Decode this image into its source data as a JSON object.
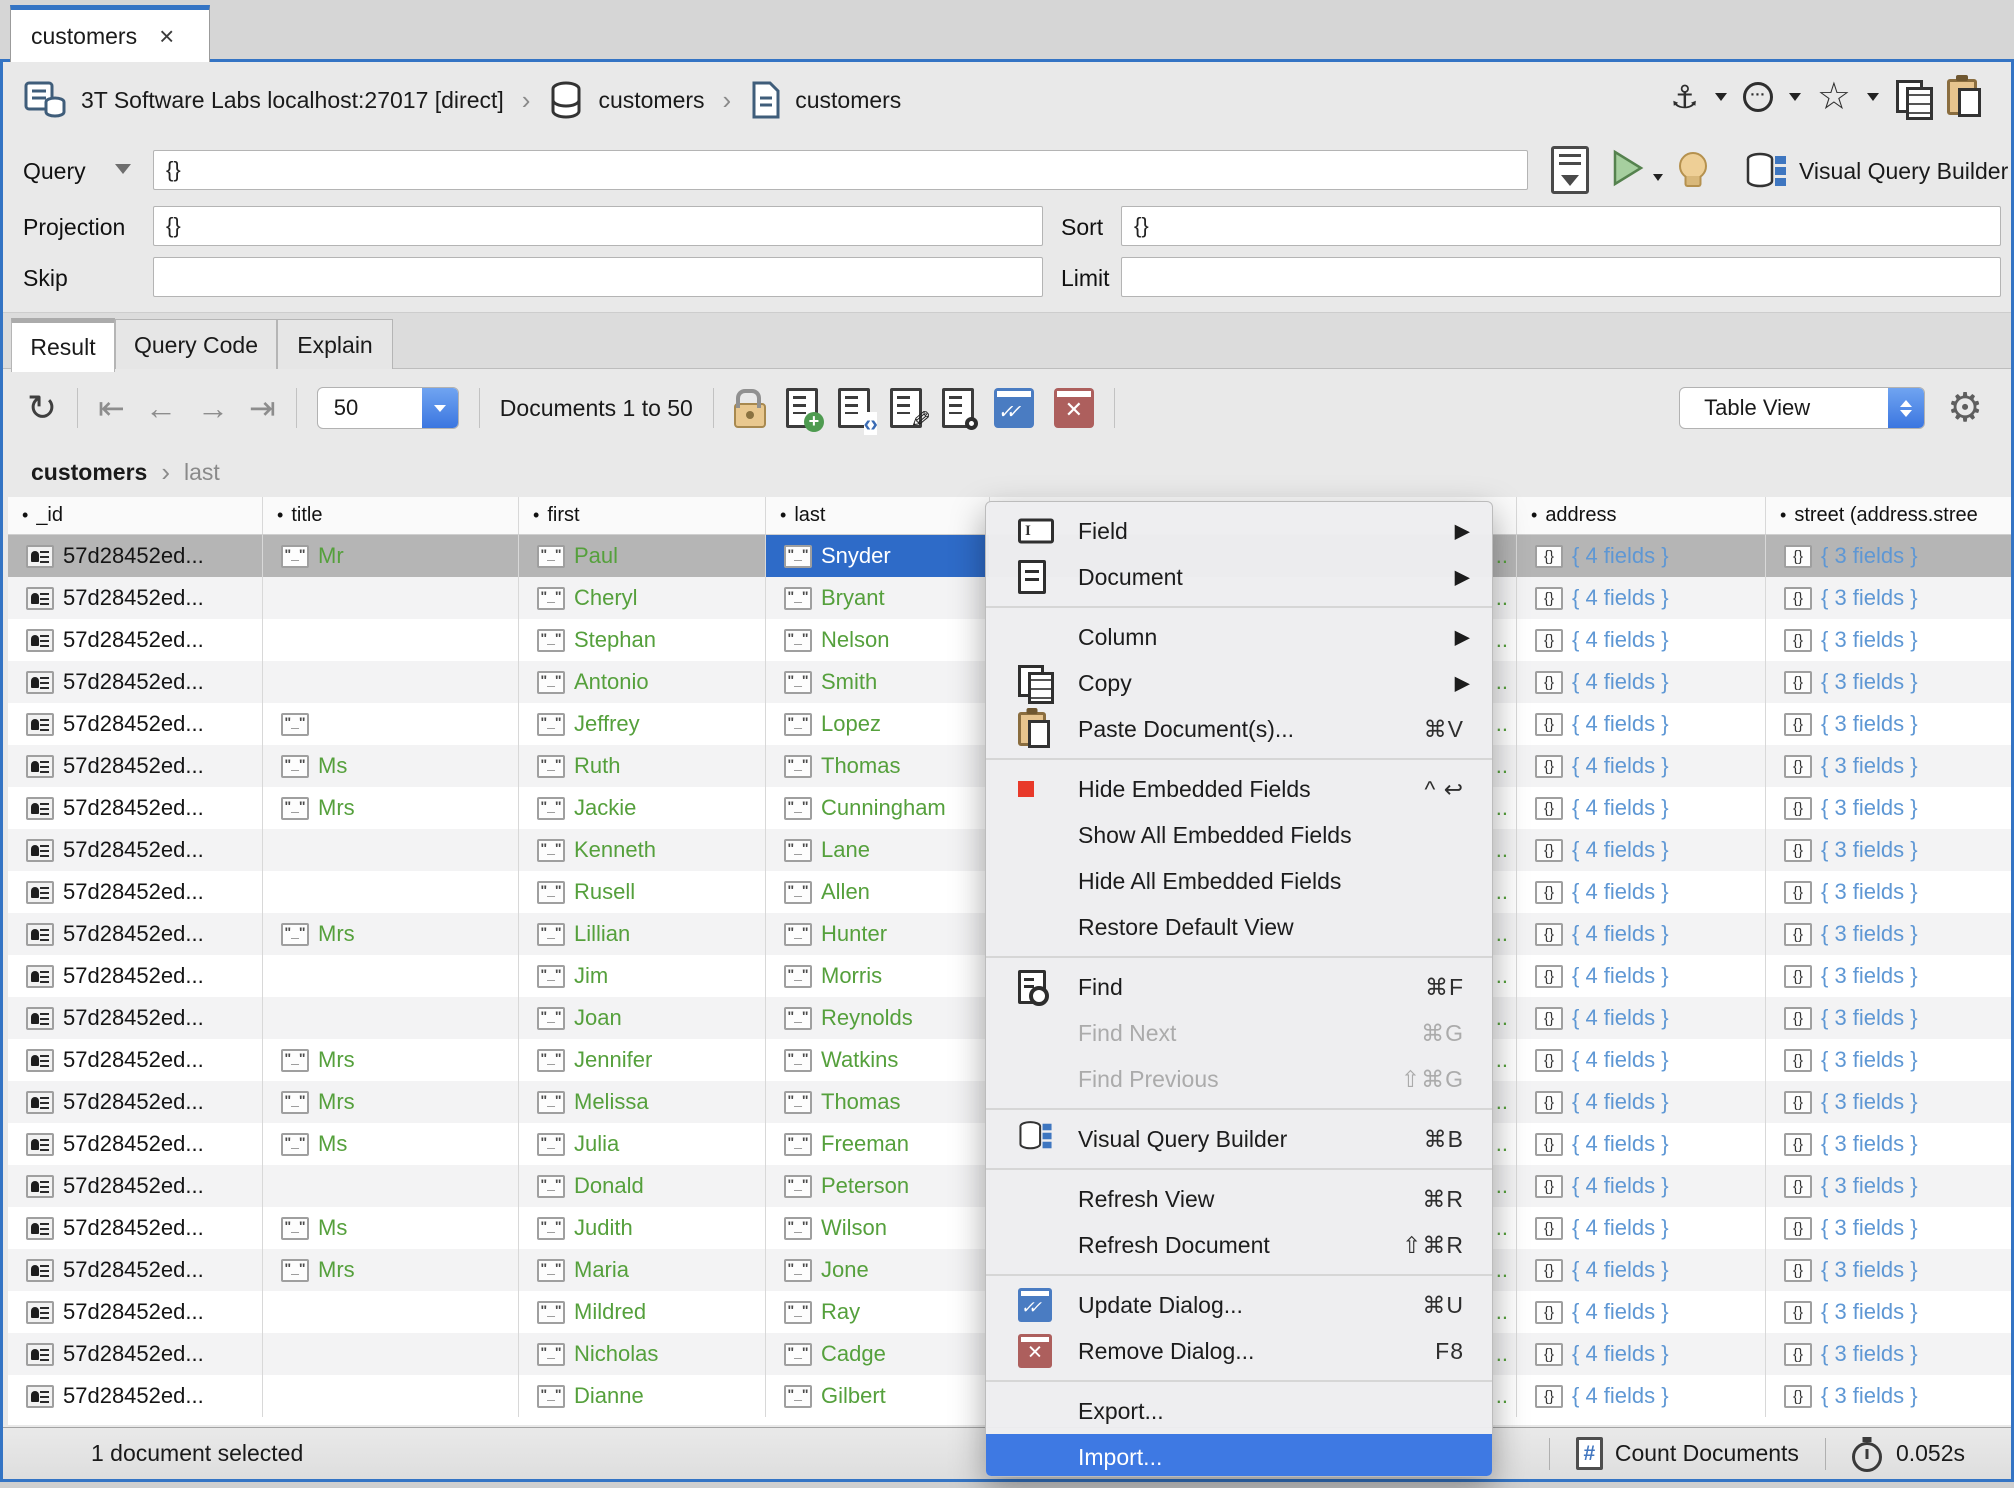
{
  "tab": {
    "title": "customers"
  },
  "breadcrumb": {
    "connection": "3T Software Labs localhost:27017 [direct]",
    "database": "customers",
    "collection": "customers"
  },
  "query_bar": {
    "query_label": "Query",
    "query_value": "{}",
    "projection_label": "Projection",
    "projection_value": "{}",
    "sort_label": "Sort",
    "sort_value": "{}",
    "skip_label": "Skip",
    "skip_value": "",
    "limit_label": "Limit",
    "limit_value": "",
    "visual_query_builder_label": "Visual Query Builder"
  },
  "result_tabs": {
    "result": "Result",
    "query_code": "Query Code",
    "explain": "Explain"
  },
  "toolbar": {
    "page_size": "50",
    "range_label": "Documents 1 to 50",
    "view_selector": "Table View"
  },
  "table": {
    "path_root": "customers",
    "path_leaf": "last",
    "bullet": "•",
    "columns": [
      "_id",
      "title",
      "first",
      "last",
      "address",
      "street (address.stree"
    ],
    "id_value": "57d28452ed...",
    "object_values": {
      "address": "{ 4 fields }",
      "street": "{ 3 fields }"
    },
    "truncated_text": "..",
    "selected_row": {
      "id": "57d28452ed...",
      "title": "Mr",
      "first": "Paul",
      "last": "Snyder",
      "address": "{ 4 fields }",
      "street": "{ 3 fields }"
    },
    "rows": [
      {
        "title": "",
        "show_title_icon": false,
        "first": "Cheryl",
        "last": "Bryant"
      },
      {
        "title": "",
        "show_title_icon": false,
        "first": "Stephan",
        "last": "Nelson"
      },
      {
        "title": "",
        "show_title_icon": false,
        "first": "Antonio",
        "last": "Smith"
      },
      {
        "title": "",
        "show_title_icon": true,
        "first": "Jeffrey",
        "last": "Lopez"
      },
      {
        "title": "Ms",
        "show_title_icon": true,
        "first": "Ruth",
        "last": "Thomas"
      },
      {
        "title": "Mrs",
        "show_title_icon": true,
        "first": "Jackie",
        "last": "Cunningham"
      },
      {
        "title": "",
        "show_title_icon": false,
        "first": "Kenneth",
        "last": "Lane"
      },
      {
        "title": "",
        "show_title_icon": false,
        "first": "Rusell",
        "last": "Allen"
      },
      {
        "title": "Mrs",
        "show_title_icon": true,
        "first": "Lillian",
        "last": "Hunter"
      },
      {
        "title": "",
        "show_title_icon": false,
        "first": "Jim",
        "last": "Morris"
      },
      {
        "title": "",
        "show_title_icon": false,
        "first": "Joan",
        "last": "Reynolds"
      },
      {
        "title": "Mrs",
        "show_title_icon": true,
        "first": "Jennifer",
        "last": "Watkins"
      },
      {
        "title": "Mrs",
        "show_title_icon": true,
        "first": "Melissa",
        "last": "Thomas"
      },
      {
        "title": "Ms",
        "show_title_icon": true,
        "first": "Julia",
        "last": "Freeman"
      },
      {
        "title": "",
        "show_title_icon": false,
        "first": "Donald",
        "last": "Peterson"
      },
      {
        "title": "Ms",
        "show_title_icon": true,
        "first": "Judith",
        "last": "Wilson"
      },
      {
        "title": "Mrs",
        "show_title_icon": true,
        "first": "Maria",
        "last": "Jone"
      },
      {
        "title": "",
        "show_title_icon": false,
        "first": "Mildred",
        "last": "Ray"
      },
      {
        "title": "",
        "show_title_icon": false,
        "first": "Nicholas",
        "last": "Cadge"
      },
      {
        "title": "",
        "show_title_icon": false,
        "first": "Dianne",
        "last": "Gilbert"
      }
    ]
  },
  "context_menu": {
    "items": [
      {
        "icon": "field-icon",
        "label": "Field",
        "submenu": true
      },
      {
        "icon": "document-icon",
        "label": "Document",
        "submenu": true
      },
      {
        "type": "separator"
      },
      {
        "label": "Column",
        "submenu": true
      },
      {
        "icon": "copy-icon",
        "label": "Copy",
        "submenu": true
      },
      {
        "icon": "paste-icon",
        "label": "Paste Document(s)...",
        "shortcut": "⌘V"
      },
      {
        "type": "separator"
      },
      {
        "icon": "red-square-icon",
        "label": "Hide Embedded Fields",
        "shortcut": "^ ↩"
      },
      {
        "label": "Show All Embedded Fields"
      },
      {
        "label": "Hide All Embedded Fields"
      },
      {
        "label": "Restore Default View"
      },
      {
        "type": "separator"
      },
      {
        "icon": "find-icon",
        "label": "Find",
        "shortcut": "⌘F"
      },
      {
        "label": "Find Next",
        "shortcut": "⌘G",
        "disabled": true
      },
      {
        "label": "Find Previous",
        "shortcut": "⇧⌘G",
        "disabled": true
      },
      {
        "type": "separator"
      },
      {
        "icon": "visual-query-builder-icon",
        "label": "Visual Query Builder",
        "shortcut": "⌘B"
      },
      {
        "type": "separator"
      },
      {
        "label": "Refresh View",
        "shortcut": "⌘R"
      },
      {
        "label": "Refresh Document",
        "shortcut": "⇧⌘R"
      },
      {
        "type": "separator"
      },
      {
        "icon": "update-dialog-icon",
        "label": "Update Dialog...",
        "shortcut": "⌘U"
      },
      {
        "icon": "remove-dialog-icon",
        "label": "Remove Dialog...",
        "shortcut": "F8"
      },
      {
        "type": "separator"
      },
      {
        "label": "Export..."
      },
      {
        "label": "Import...",
        "highlighted": true
      }
    ]
  },
  "status_bar": {
    "selection": "1 document selected",
    "count_label": "Count Documents",
    "time": "0.052s"
  },
  "colors": {
    "accent_blue": "#3474c4",
    "selection_blue": "#2e6bc8",
    "menu_highlight_blue": "#3e79e3",
    "string_green": "#55a03c",
    "object_blue": "#5e97d4"
  }
}
